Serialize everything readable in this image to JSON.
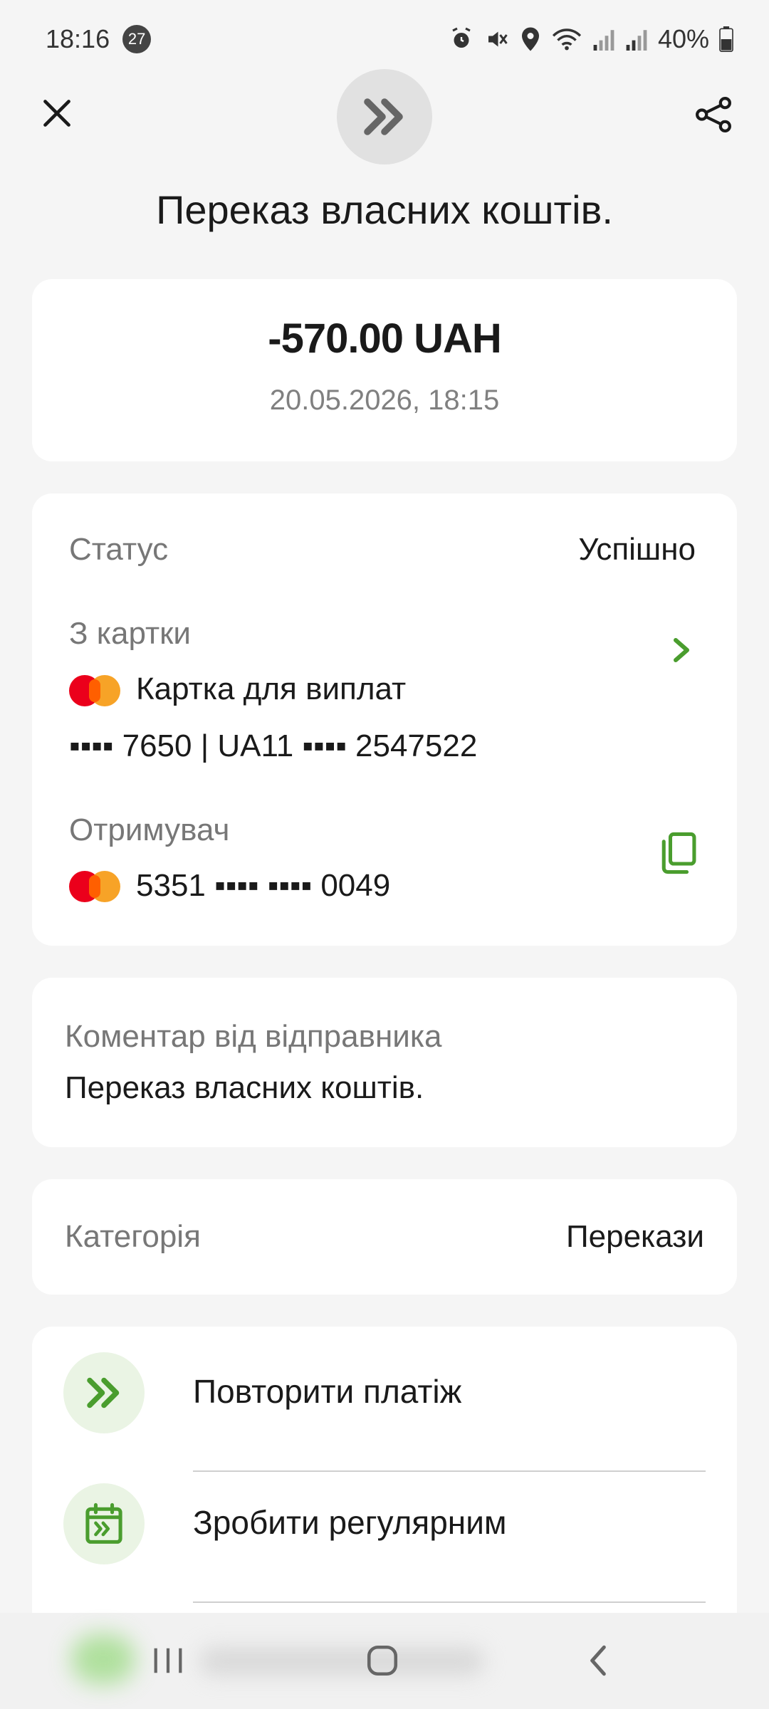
{
  "status_bar": {
    "time": "18:16",
    "notification_count": "27",
    "battery": "40%"
  },
  "header": {
    "title": "Переказ власних коштів.",
    "icons": {
      "close": "close-icon",
      "transfer": "double-chevron-right-icon",
      "share": "share-icon"
    }
  },
  "amount_card": {
    "amount": "-570.00 UAH",
    "datetime": "20.05.2026, 18:15"
  },
  "details": {
    "status_label": "Статус",
    "status_value": "Успішно",
    "from_label": "З картки",
    "from_card_name": "Картка для виплат",
    "from_card_number": "▪▪▪▪ 7650 | UA11 ▪▪▪▪ 2547522",
    "recipient_label": "Отримувач",
    "recipient_card_number": "5351 ▪▪▪▪ ▪▪▪▪ 0049"
  },
  "comment": {
    "label": "Коментар від відправника",
    "text": "Переказ власних коштів."
  },
  "category": {
    "label": "Категорія",
    "value": "Перекази"
  },
  "actions": [
    {
      "label": "Повторити платіж",
      "icon": "repeat-payment-icon"
    },
    {
      "label": "Зробити регулярним",
      "icon": "calendar-icon"
    }
  ],
  "colors": {
    "accent_green": "#4a9d2e",
    "background": "#f5f5f5",
    "card": "#ffffff",
    "mastercard_red": "#eb001b",
    "mastercard_orange": "#f79e1b"
  }
}
